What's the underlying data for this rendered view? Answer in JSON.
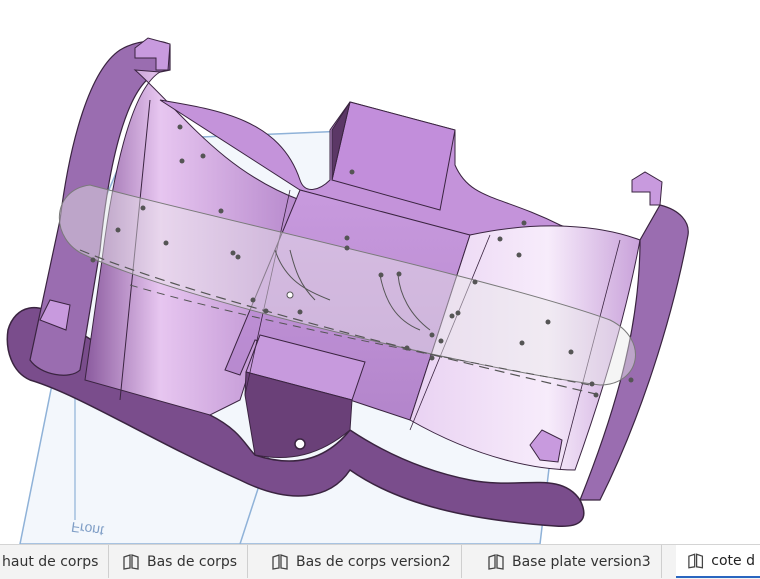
{
  "viewport": {
    "plane_label": "Front",
    "colors": {
      "face_light": "#d9b0e8",
      "face_mid": "#b98bd0",
      "face_dark": "#7a4d8c",
      "edge": "#3a2440",
      "plane_edge": "#8fb2d8",
      "plane_fill": "#dbe6f3"
    }
  },
  "tabs": [
    {
      "label": "haut de corps",
      "icon": "part-studio-icon",
      "active": false
    },
    {
      "label": "Bas de corps",
      "icon": "part-studio-icon",
      "active": false
    },
    {
      "label": "Bas de corps version2",
      "icon": "part-studio-icon",
      "active": false
    },
    {
      "label": "Base plate version3",
      "icon": "part-studio-icon",
      "active": false
    },
    {
      "label": "cote d",
      "icon": "part-studio-icon",
      "active": true
    }
  ]
}
